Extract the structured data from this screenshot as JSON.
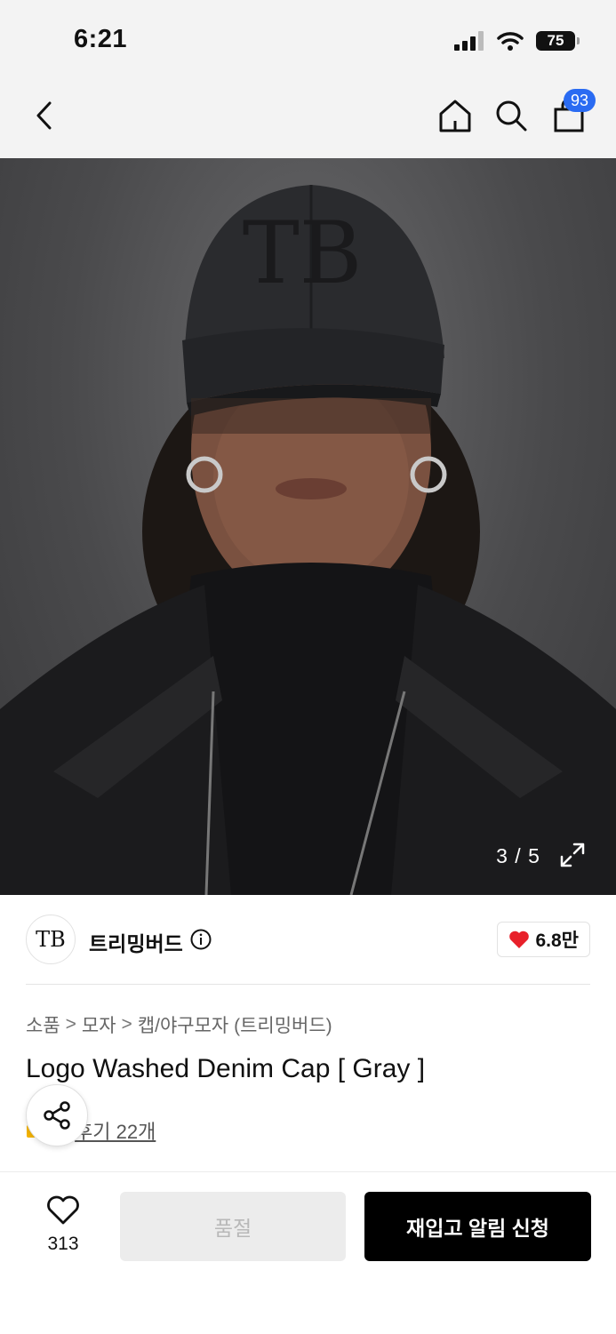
{
  "status_bar": {
    "time": "6:21",
    "battery": "75"
  },
  "nav": {
    "cart_count": "93"
  },
  "gallery": {
    "counter": "3 / 5"
  },
  "brand": {
    "logo_text": "TB",
    "name": "트리밍버드",
    "likes": "6.8만"
  },
  "breadcrumb": {
    "level1": "소품",
    "sep": ">",
    "level2": "모자",
    "level3": "캡/야구모자 (트리밍버드)"
  },
  "product": {
    "title": "Logo Washed Denim Cap [ Gray ]",
    "reviews_label": "후기 22개"
  },
  "bottom": {
    "wish_count": "313",
    "soldout_label": "품절",
    "restock_label": "재입고 알림 신청"
  },
  "colors": {
    "badge": "#2a6bf2",
    "heart": "#e8202a",
    "primary": "#000000"
  }
}
